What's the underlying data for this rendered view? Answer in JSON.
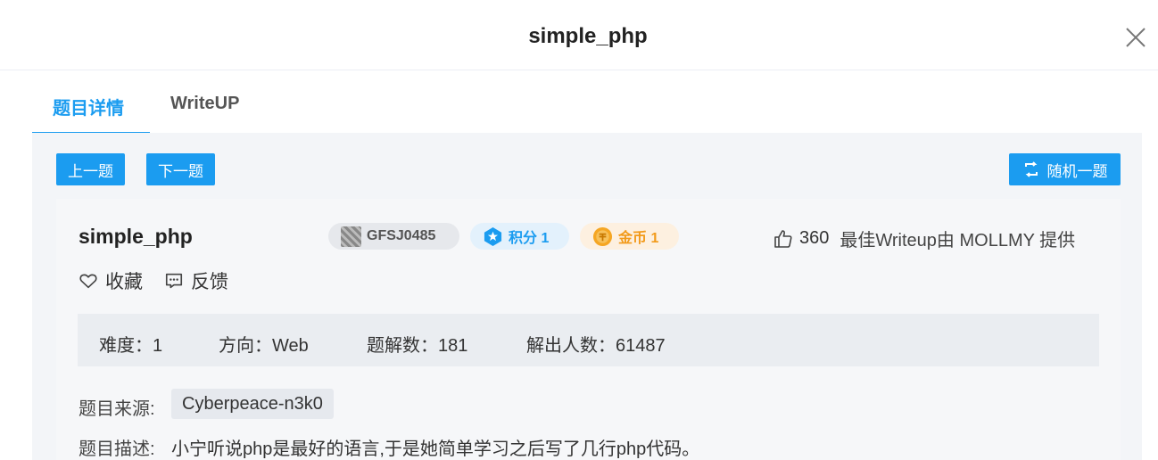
{
  "header": {
    "title": "simple_php"
  },
  "tabs": [
    {
      "label": "题目详情",
      "active": true
    },
    {
      "label": "WriteUP",
      "active": false
    }
  ],
  "nav": {
    "prev_label": "上一题",
    "next_label": "下一题",
    "random_label": "随机一题"
  },
  "challenge": {
    "name": "simple_php",
    "badges": {
      "id_label": "GFSJ0485",
      "score_label": "积分 1",
      "coin_label": "金币 1"
    },
    "likes": "360",
    "writeup_credit": "最佳Writeup由 MOLLMY 提供",
    "favorite_label": "收藏",
    "feedback_label": "反馈",
    "stats": {
      "difficulty": "难度：1",
      "direction": "方向：Web",
      "solves": "题解数：181",
      "solvers": "解出人数：61487"
    },
    "source_label": "题目来源:",
    "source_value": "Cyberpeace-n3k0",
    "desc_label": "题目描述:",
    "desc_value": "小宁听说php是最好的语言,于是她简单学习之后写了几行php代码。"
  },
  "colors": {
    "accent": "#1b9cf0",
    "score_bg": "#e3f1fc",
    "coin_bg": "#fdf0e0",
    "coin_text": "#f29a1a",
    "id_bg": "#e6e8ec"
  },
  "icons": {
    "close": "close-icon",
    "random": "shuffle-icon",
    "score": "star-icon",
    "coin": "coin-icon",
    "like": "thumbs-up-icon",
    "favorite": "heart-icon",
    "feedback": "message-icon"
  }
}
